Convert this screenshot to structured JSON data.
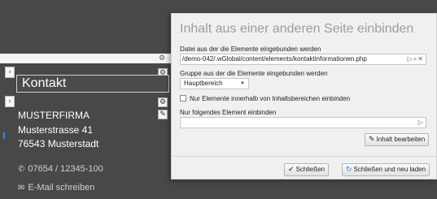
{
  "page": {
    "heading": "Kontakt",
    "company": "MUSTERFIRMA",
    "street": "Musterstrasse 41",
    "city": "76543 Musterstadt",
    "phone": "07654 / 12345-100",
    "email_link": "E-Mail schreiben"
  },
  "dialog": {
    "title": "Inhalt aus einer anderen Seite einbinden",
    "file_label": "Datei aus der die Elemente eingebunden werden",
    "file_value": "/demo-042/.wGlobal/content/elements/kontaktinformationen.php",
    "group_label": "Gruppe aus der die Elemente eingebunden werden",
    "group_value": "Hauptbereich",
    "checkbox_label": "Nur Elemente innerhalb von Inhaltsbereichen einbinden",
    "element_label": "Nur folgendes Element einbinden",
    "element_value": "",
    "edit_button": "Inhalt bearbeiten",
    "close_button": "Schließen",
    "close_reload_button": "Schließen und neu laden"
  },
  "colors": {
    "accent_green": "#2e8b2e",
    "accent_blue": "#3a7bd5",
    "page_bg": "#484848",
    "dialog_bg": "#f0f0f0"
  },
  "icons": [
    "settings-icon",
    "marker-arrow-icon",
    "edit-pencil-icon",
    "phone-icon",
    "mail-icon",
    "browse-icon",
    "search-icon",
    "clear-icon",
    "checkmark-icon",
    "reload-icon"
  ]
}
